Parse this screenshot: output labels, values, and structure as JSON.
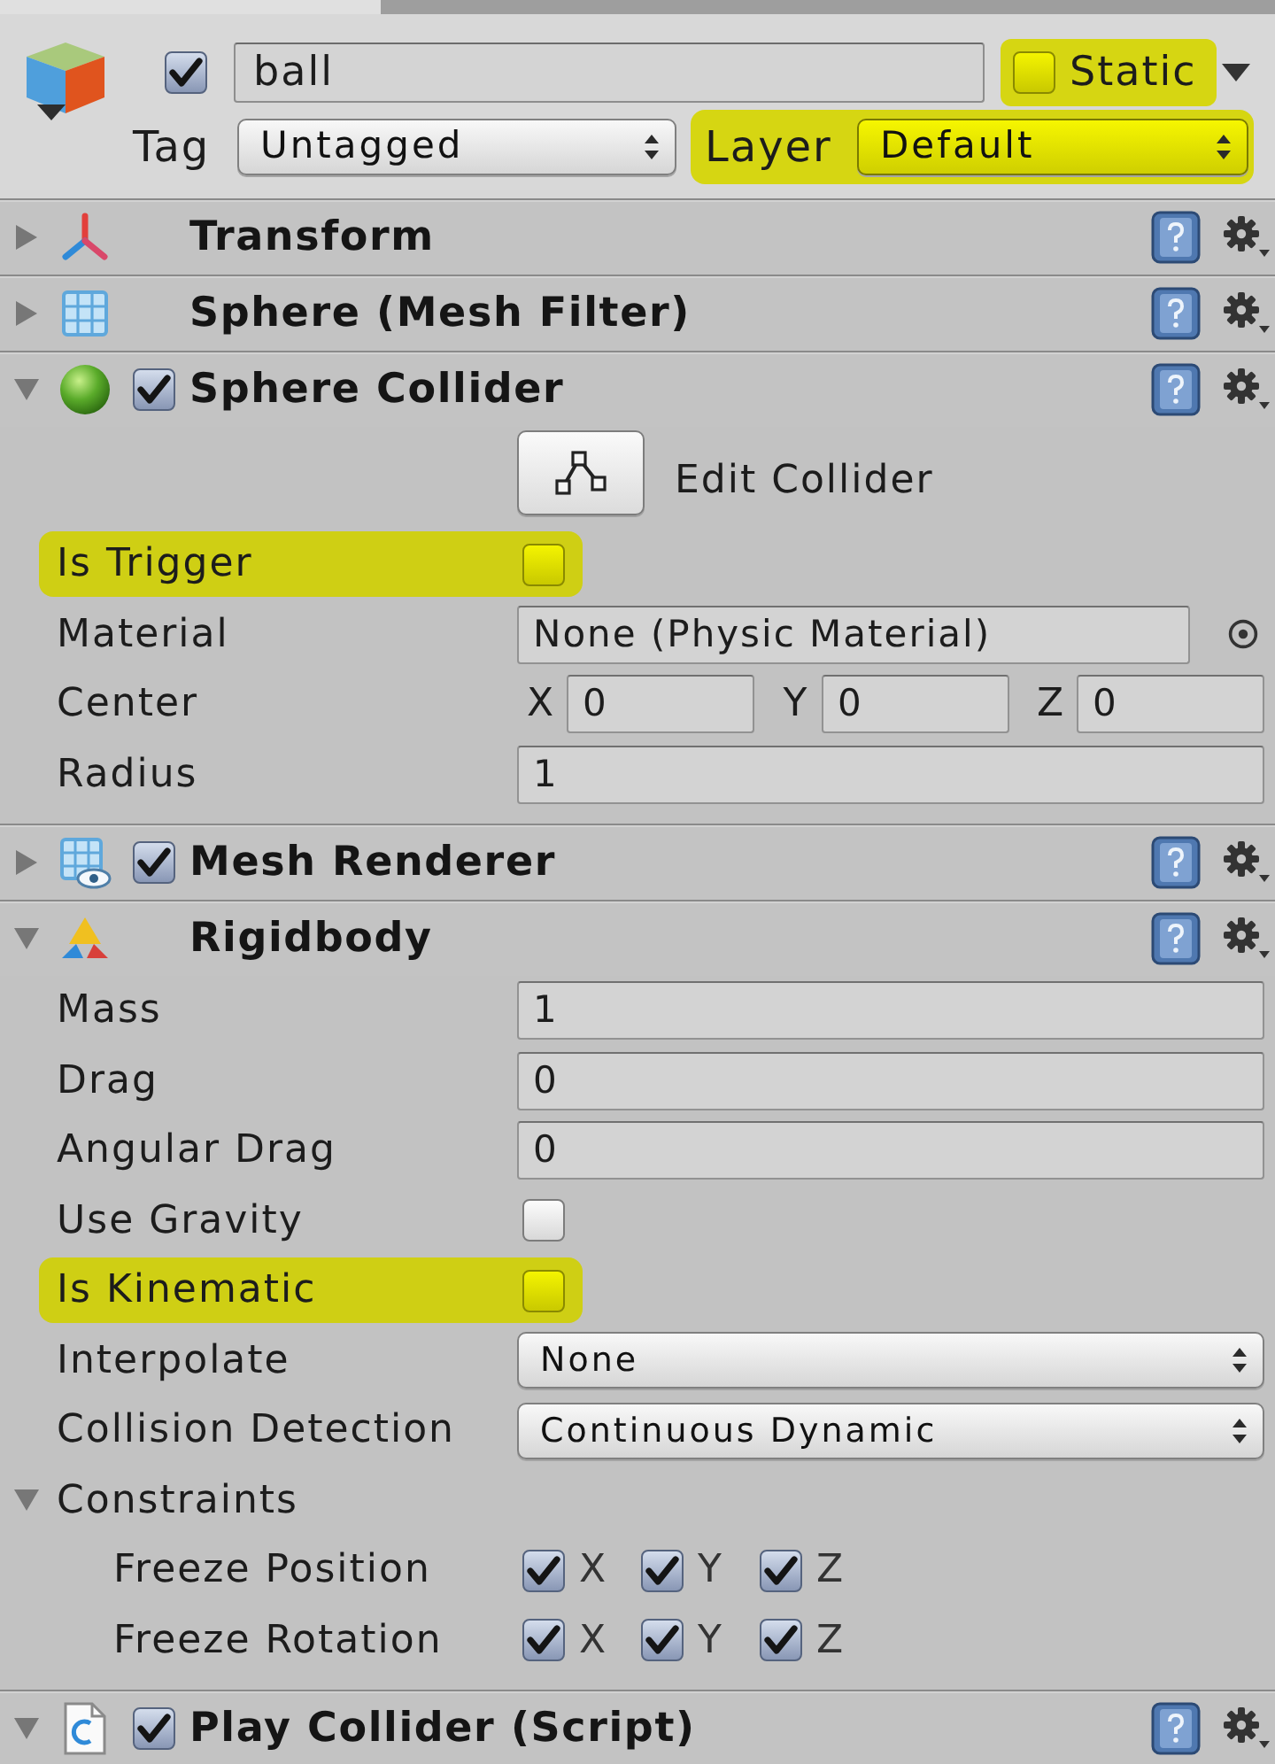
{
  "game_object": {
    "active": true,
    "name": "ball",
    "static": {
      "label": "Static",
      "checked": false,
      "highlighted": true
    },
    "tag": {
      "label": "Tag",
      "value": "Untagged",
      "highlighted": false
    },
    "layer": {
      "label": "Layer",
      "value": "Default",
      "highlighted": true
    }
  },
  "components": [
    {
      "kind": "transform",
      "title": "Transform",
      "expanded": false
    },
    {
      "kind": "mesh_filter",
      "title": "Sphere (Mesh Filter)",
      "expanded": false
    },
    {
      "kind": "sphere_collider",
      "title": "Sphere Collider",
      "enabled": true,
      "expanded": true,
      "properties": [
        {
          "kind": "button",
          "label": "Edit Collider"
        },
        {
          "kind": "checkbox",
          "label": "Is Trigger",
          "checked": false,
          "highlighted": true
        },
        {
          "kind": "object",
          "label": "Material",
          "value": "None (Physic Material)"
        },
        {
          "kind": "vector3",
          "label": "Center",
          "axes": [
            {
              "axis": "X",
              "value": "0"
            },
            {
              "axis": "Y",
              "value": "0"
            },
            {
              "axis": "Z",
              "value": "0"
            }
          ]
        },
        {
          "kind": "field",
          "label": "Radius",
          "value": "1"
        }
      ]
    },
    {
      "kind": "mesh_renderer",
      "title": "Mesh Renderer",
      "enabled": true,
      "expanded": false
    },
    {
      "kind": "rigidbody",
      "title": "Rigidbody",
      "expanded": true,
      "properties": [
        {
          "kind": "field",
          "label": "Mass",
          "value": "1"
        },
        {
          "kind": "field",
          "label": "Drag",
          "value": "0"
        },
        {
          "kind": "field",
          "label": "Angular Drag",
          "value": "0"
        },
        {
          "kind": "checkbox",
          "label": "Use Gravity",
          "checked": false,
          "highlighted": false
        },
        {
          "kind": "checkbox",
          "label": "Is Kinematic",
          "checked": false,
          "highlighted": true
        },
        {
          "kind": "dropdown",
          "label": "Interpolate",
          "value": "None"
        },
        {
          "kind": "dropdown",
          "label": "Collision Detection",
          "value": "Continuous Dynamic"
        },
        {
          "kind": "foldout",
          "label": "Constraints",
          "expanded": true,
          "children": [
            {
              "label": "Freeze Position",
              "toggles": [
                {
                  "axis": "X",
                  "checked": true
                },
                {
                  "axis": "Y",
                  "checked": true
                },
                {
                  "axis": "Z",
                  "checked": true
                }
              ]
            },
            {
              "label": "Freeze Rotation",
              "toggles": [
                {
                  "axis": "X",
                  "checked": true
                },
                {
                  "axis": "Y",
                  "checked": true
                },
                {
                  "axis": "Z",
                  "checked": true
                }
              ]
            }
          ]
        }
      ]
    },
    {
      "kind": "script",
      "title": "Play Collider (Script)",
      "enabled": true,
      "expanded": true
    }
  ]
}
